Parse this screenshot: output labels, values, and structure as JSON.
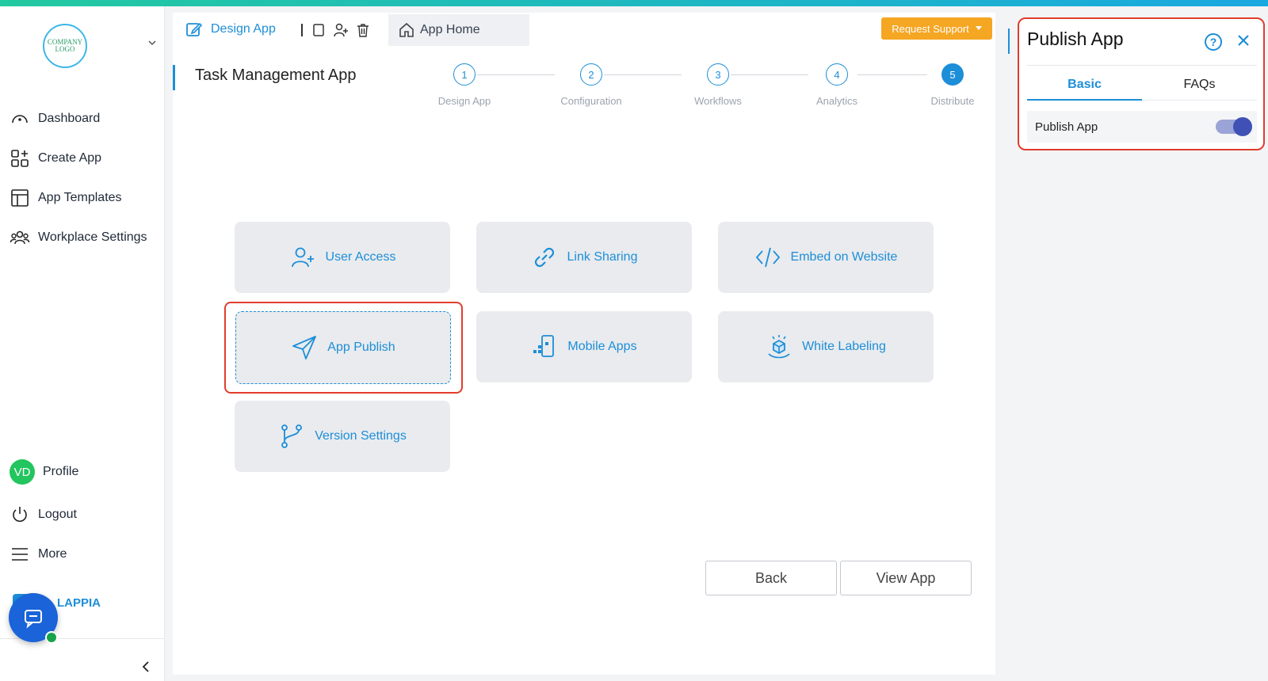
{
  "sidebar": {
    "logo_text": "COMPANY LOGO",
    "items": [
      {
        "label": "Dashboard"
      },
      {
        "label": "Create App"
      },
      {
        "label": "App Templates"
      },
      {
        "label": "Workplace Settings"
      }
    ],
    "profile": {
      "initials": "VD",
      "label": "Profile"
    },
    "logout_label": "Logout",
    "more_label": "More",
    "brand": "LAPPIA"
  },
  "header": {
    "design_tab": "Design App",
    "home_tab": "App Home",
    "request_support": "Request Support"
  },
  "app_title": "Task Management App",
  "steps": [
    {
      "num": "1",
      "label": "Design App"
    },
    {
      "num": "2",
      "label": "Configuration"
    },
    {
      "num": "3",
      "label": "Workflows"
    },
    {
      "num": "4",
      "label": "Analytics"
    },
    {
      "num": "5",
      "label": "Distribute"
    }
  ],
  "cards": {
    "user_access": "User Access",
    "link_sharing": "Link Sharing",
    "embed": "Embed on Website",
    "app_publish": "App Publish",
    "mobile_apps": "Mobile Apps",
    "white_labeling": "White Labeling",
    "version_settings": "Version Settings"
  },
  "buttons": {
    "back": "Back",
    "view_app": "View App"
  },
  "panel": {
    "title": "Publish App",
    "help": "?",
    "tabs": [
      "Basic",
      "FAQs"
    ],
    "row_label": "Publish App",
    "toggle_on": true
  },
  "colors": {
    "accent": "#1d8ed8",
    "highlight": "#e23c2d",
    "support": "#f5a623"
  }
}
